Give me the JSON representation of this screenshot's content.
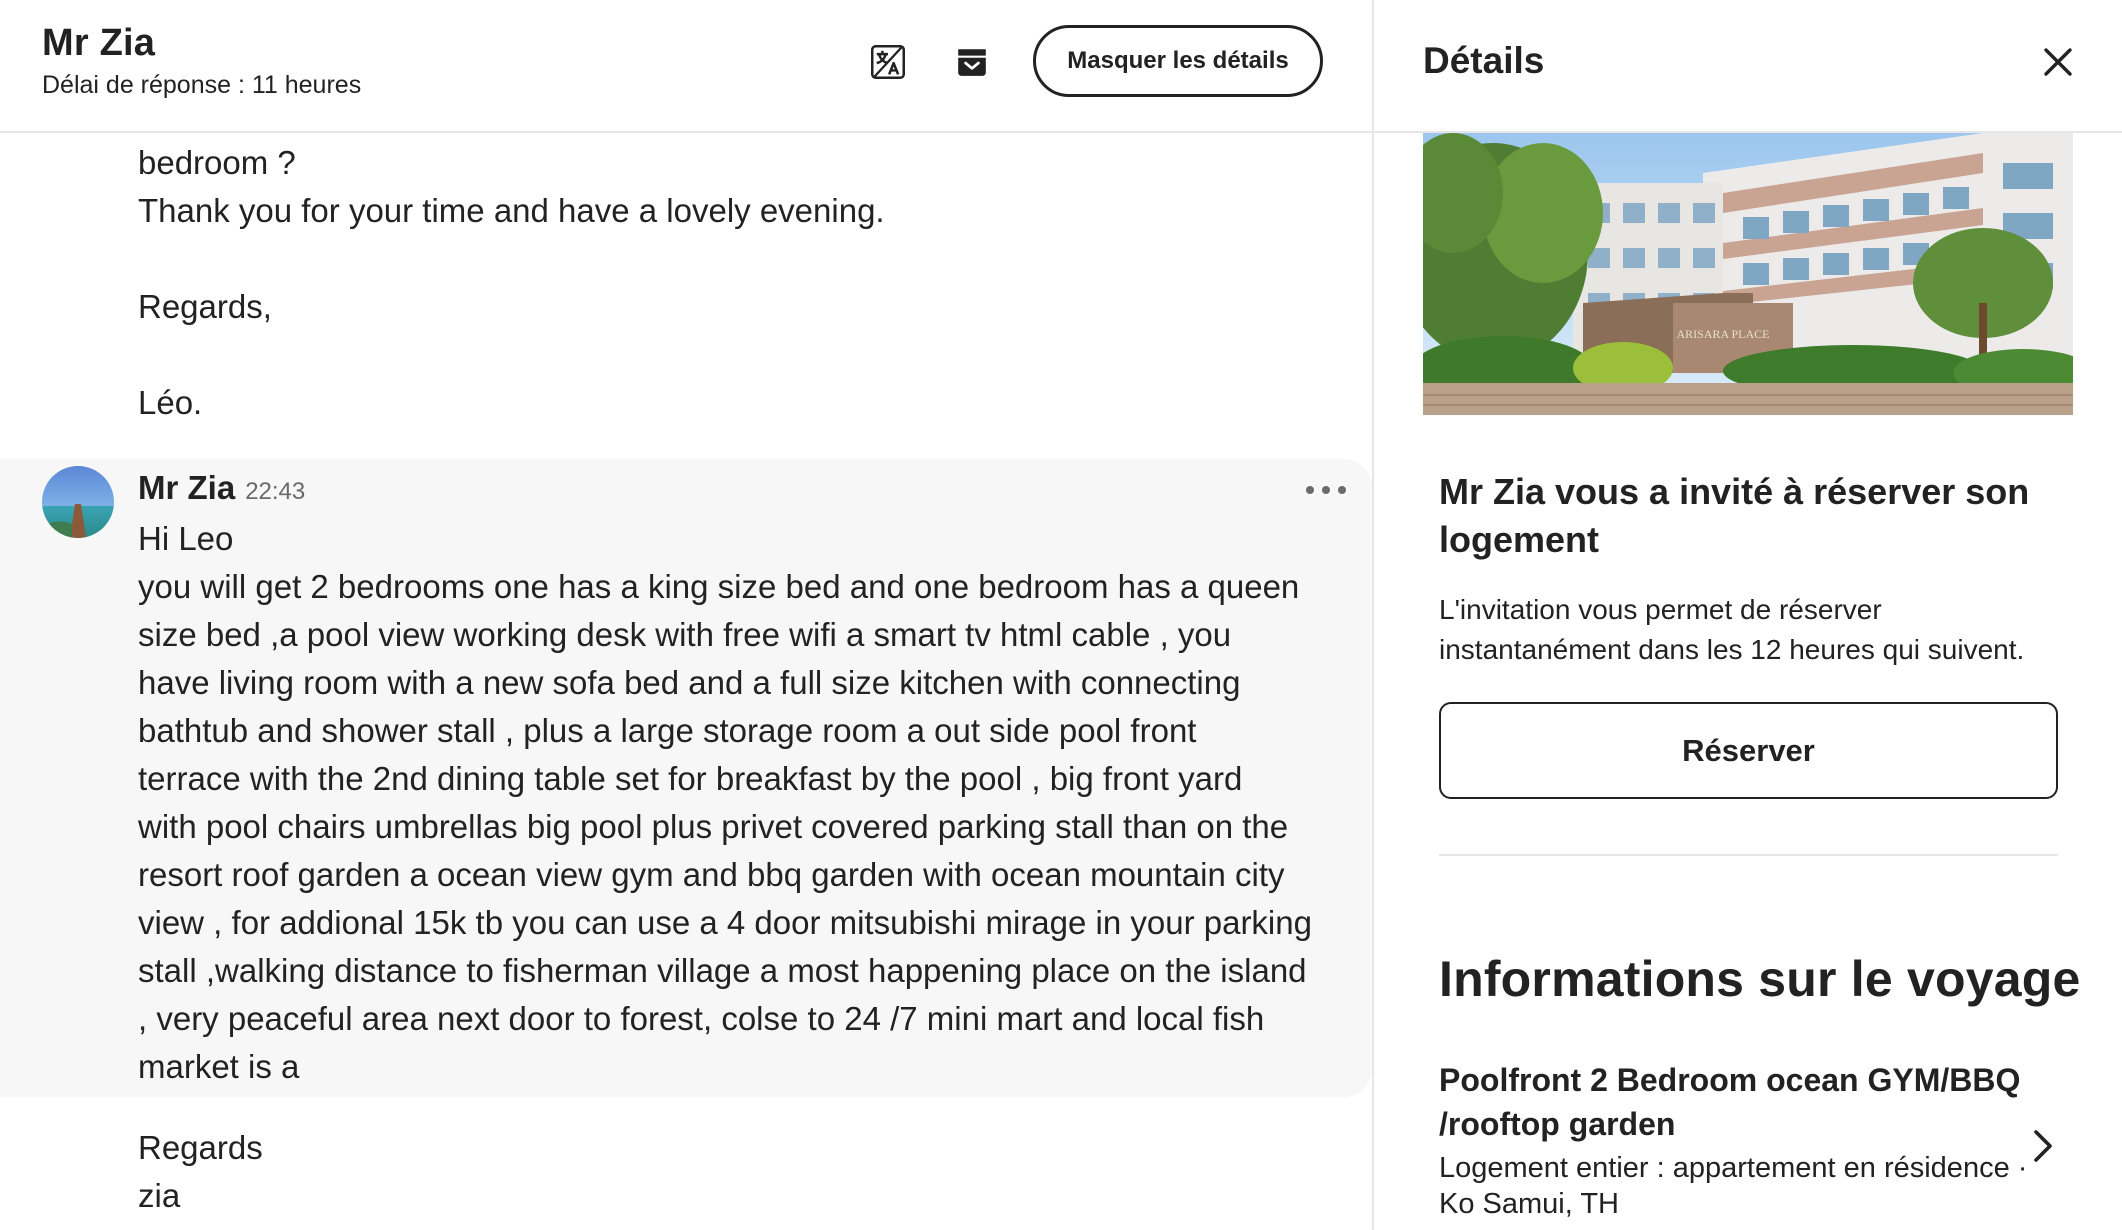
{
  "conversation": {
    "host_name": "Mr Zia",
    "response_time": "Délai de réponse : 11 heures",
    "hide_details_label": "Masquer les détails",
    "icons": [
      "translate-icon",
      "archive-icon"
    ],
    "previous_message_tail": [
      "bedroom ?",
      "Thank you for your time and have a lovely evening.",
      "",
      "Regards,",
      "",
      "Léo."
    ],
    "reply": {
      "sender": "Mr Zia",
      "time": "22:43",
      "lines": [
        "Hi Leo",
        "you will get 2 bedrooms one has a king size bed and one bedroom has a queen",
        "size bed ,a pool view working desk with free wifi a smart tv html cable , you",
        "have living room with a new sofa bed and a full size kitchen with connecting",
        "bathtub and shower stall , plus a large storage room a out side pool front",
        "terrace with the 2nd dining table set for breakfast by the pool , big front yard",
        "with pool chairs umbrellas big pool plus privet covered parking stall than on the",
        "resort roof garden a ocean view gym and bbq garden with ocean mountain city",
        "view , for addional 15k tb you can use a 4 door mitsubishi mirage in your parking",
        "stall ,walking distance to fisherman village a most happening place on the island",
        ", very peaceful area next door to forest, colse to 24 /7 mini mart and local fish",
        "market is a"
      ],
      "signoff": [
        "Regards",
        "zia"
      ]
    }
  },
  "details": {
    "title": "Détails",
    "photo_sign_text": "ARISARA PLACE",
    "invite": {
      "title": "Mr Zia vous a invité à réserver son logement",
      "description": "L'invitation vous permet de réserver instantanément dans les 12 heures qui suivent.",
      "reserve_label": "Réserver"
    },
    "trip": {
      "heading": "Informations sur le voyage",
      "listing_title": "Poolfront 2 Bedroom ocean GYM/BBQ /rooftop garden",
      "listing_subtitle": "Logement entier : appartement en résidence · Ko Samui, TH"
    }
  },
  "colors": {
    "text": "#222222",
    "muted": "#6a6a6a",
    "border": "#e6e6e6",
    "highlight_bg": "#f7f7f7"
  }
}
